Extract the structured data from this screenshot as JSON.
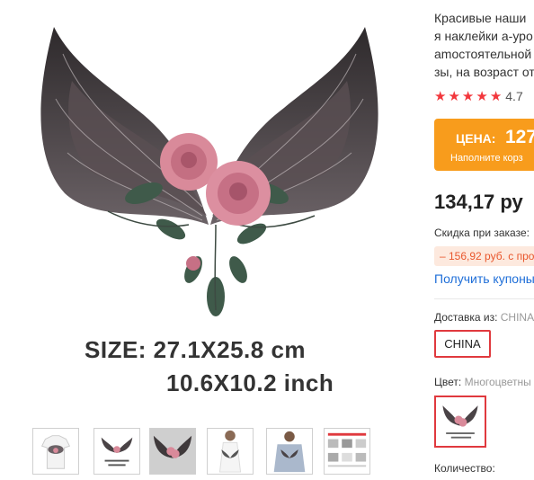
{
  "product_image": {
    "size_line1": "SIZE:  27.1X25.8 cm",
    "size_line2": "10.6X10.2 inch"
  },
  "thumbnails": [
    {
      "name": "thumbnail-tshirt-front"
    },
    {
      "name": "thumbnail-wings-size"
    },
    {
      "name": "thumbnail-wings-closeup"
    },
    {
      "name": "thumbnail-model-halter"
    },
    {
      "name": "thumbnail-model-sweater"
    },
    {
      "name": "thumbnail-instructions"
    }
  ],
  "product": {
    "title": "Красивые наши\nя наклейки а-уро\namостоятельной\nзы, на возраст от",
    "rating": {
      "stars": 5,
      "value": "4.7"
    },
    "price_box": {
      "label": "ЦЕНА:",
      "value": "127",
      "sub": "Наполните корз"
    },
    "price": "134,17 ру",
    "discount_label": "Скидка при заказе:",
    "discount_value": "– 156,92 руб. с про",
    "coupons_link": "Получить купоны",
    "shipping": {
      "label": "Доставка из:",
      "value": "CHINA",
      "option": "CHINA"
    },
    "color": {
      "label": "Цвет:",
      "value": "Многоцветны"
    },
    "quantity_label": "Количество:"
  },
  "colors": {
    "accent_red": "#e0393e",
    "price_orange": "#f89c1c",
    "link_blue": "#1e6ed8",
    "discount_text": "#e9572d",
    "star_red": "#f2373c"
  }
}
